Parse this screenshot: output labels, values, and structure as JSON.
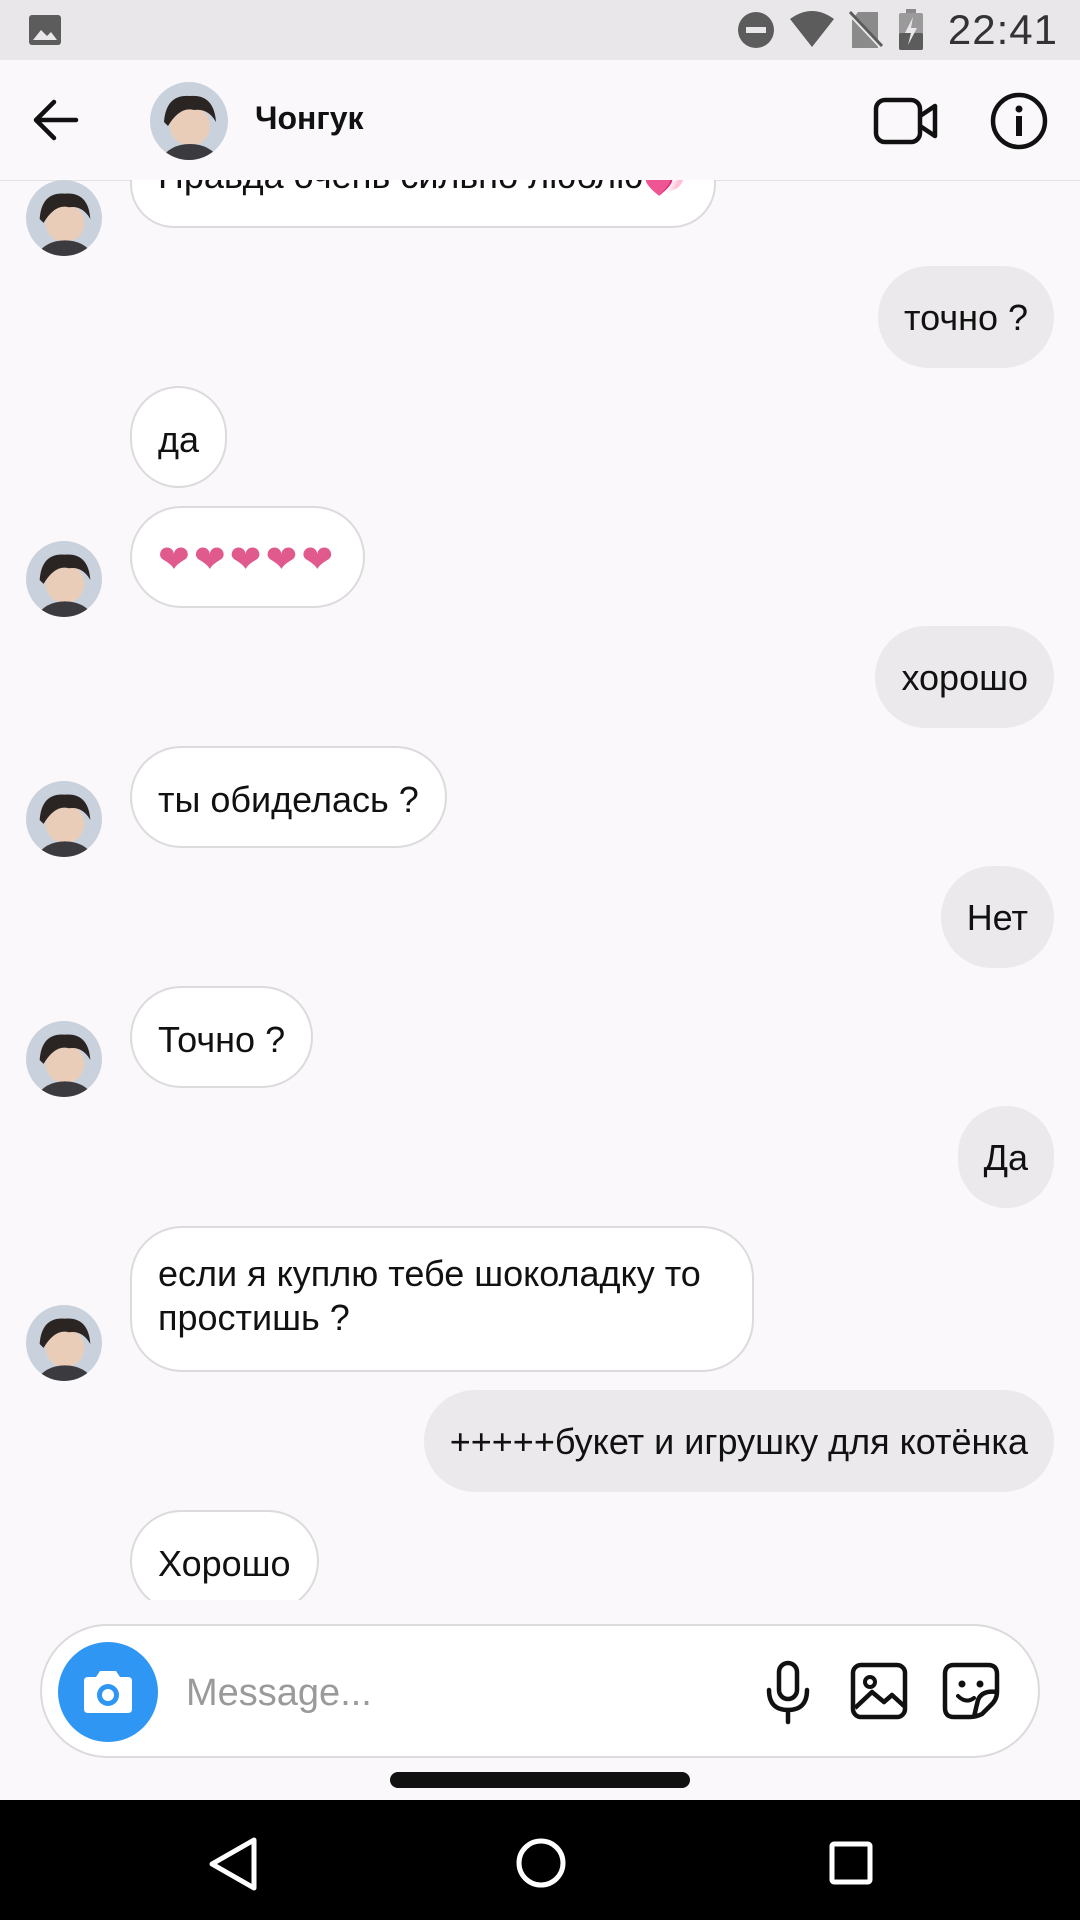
{
  "status_bar": {
    "time": "22:41",
    "icons": [
      "image-icon",
      "do-not-disturb-icon",
      "wifi-icon",
      "no-sim-icon",
      "battery-charging-icon"
    ]
  },
  "header": {
    "contact_name": "Чонгук",
    "back_icon": "arrow-left-icon",
    "video_icon": "video-camera-icon",
    "info_icon": "info-icon"
  },
  "messages": [
    {
      "direction": "incoming",
      "text": "Правда очень сильно люблю💞"
    },
    {
      "direction": "outgoing",
      "text": "точно ?"
    },
    {
      "direction": "incoming",
      "text": "да"
    },
    {
      "direction": "incoming",
      "text": "❤❤❤❤❤"
    },
    {
      "direction": "outgoing",
      "text": "хорошо"
    },
    {
      "direction": "incoming",
      "text": "ты обиделась ?"
    },
    {
      "direction": "outgoing",
      "text": "Нет"
    },
    {
      "direction": "incoming",
      "text": "Точно ?"
    },
    {
      "direction": "outgoing",
      "text": "Да"
    },
    {
      "direction": "incoming",
      "text": "если я куплю тебе шоколадку то простишь ?"
    },
    {
      "direction": "outgoing",
      "text": "+++++букет и игрушку для котёнка"
    },
    {
      "direction": "incoming",
      "text": "Хорошо"
    }
  ],
  "composer": {
    "placeholder": "Message...",
    "value": "",
    "camera_icon": "camera-icon",
    "mic_icon": "microphone-icon",
    "gallery_icon": "gallery-icon",
    "sticker_icon": "sticker-icon"
  },
  "nav_bar": {
    "icons": [
      "nav-back-icon",
      "nav-home-icon",
      "nav-recents-icon"
    ]
  },
  "colors": {
    "camera_button": "#2f96f3",
    "heart": "#e05a8d",
    "outgoing_bubble": "#ebe9ec",
    "background": "#faf8fb"
  }
}
